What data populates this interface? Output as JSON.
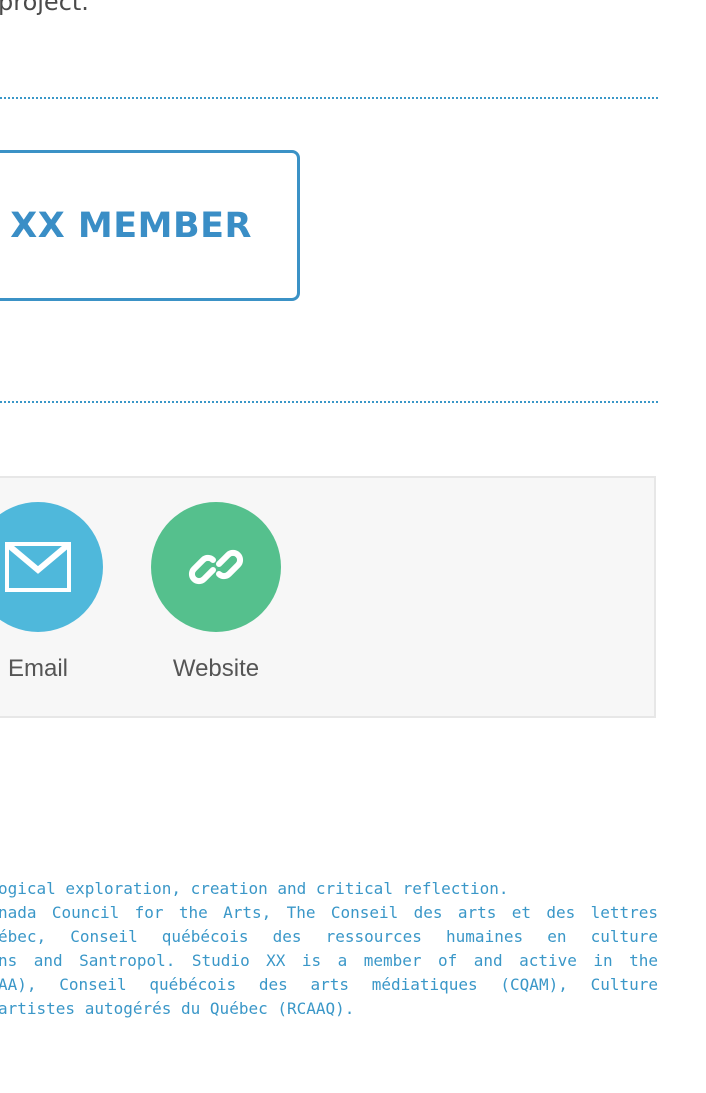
{
  "intro": {
    "text": "project."
  },
  "member_button": {
    "label": "XX MEMBER"
  },
  "share": {
    "items": [
      {
        "label": "Email",
        "icon": "envelope-icon",
        "color": "#4fb8db"
      },
      {
        "label": "Website",
        "icon": "link-icon",
        "color": "#55c08d"
      }
    ]
  },
  "footer": {
    "lines": [
      "ogical exploration, creation and critical reflection.",
      "nada Council for the Arts, The Conseil des arts et des lettres",
      "ébec, Conseil québécois des ressources humaines en culture",
      "ns and Santropol. Studio XX is a member of and active in the",
      "AA), Conseil québécois des arts médiatiques (CQAM), Culture",
      "artistes autogérés du Québec (RCAAQ)."
    ]
  },
  "colors": {
    "accent": "#3a8ec6",
    "email": "#4fb8db",
    "website": "#55c08d",
    "panel_bg": "#f7f7f7"
  }
}
